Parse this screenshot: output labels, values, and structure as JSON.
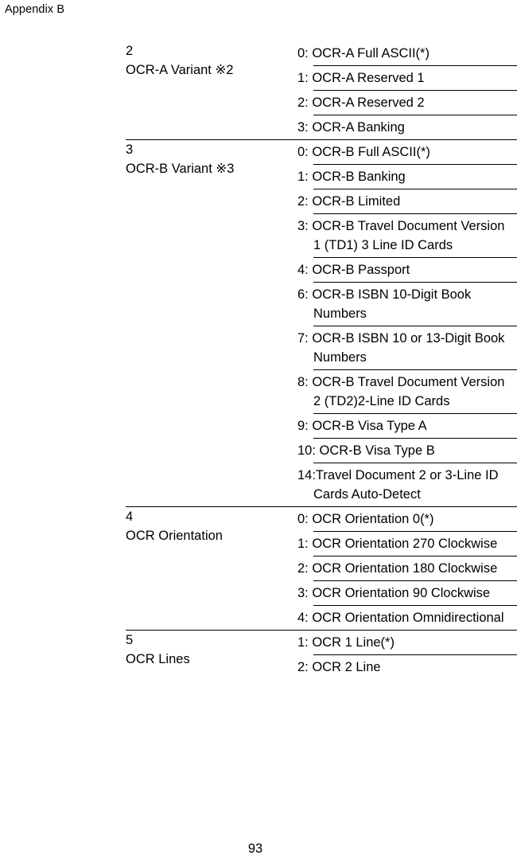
{
  "header": {
    "running_head": "Appendix B"
  },
  "footer": {
    "page_number": "93"
  },
  "table": {
    "groups": [
      {
        "number": "2",
        "name": "OCR-A Variant ※2",
        "options": [
          "0: OCR-A Full ASCII(*)",
          "1: OCR-A Reserved 1",
          "2: OCR-A Reserved 2",
          "3: OCR-A Banking"
        ]
      },
      {
        "number": "3",
        "name": "OCR-B Variant ※3",
        "options": [
          "0: OCR-B Full ASCII(*)",
          "1: OCR-B Banking",
          "2: OCR-B Limited",
          "3: OCR-B Travel Document Version 1 (TD1) 3 Line ID Cards",
          "4: OCR-B Passport",
          "6: OCR-B ISBN 10-Digit Book Numbers",
          "7: OCR-B ISBN 10 or 13-Digit Book Numbers",
          "8: OCR-B Travel Document Version 2 (TD2)2-Line ID Cards",
          "9: OCR-B Visa Type A",
          "10: OCR-B Visa Type B",
          "14:Travel Document 2 or 3-Line ID Cards Auto-Detect"
        ]
      },
      {
        "number": "4",
        "name": "OCR Orientation",
        "options": [
          "0: OCR Orientation 0(*)",
          "1: OCR Orientation 270 Clockwise",
          "2: OCR Orientation 180 Clockwise",
          "3: OCR Orientation 90 Clockwise",
          "4: OCR Orientation Omnidirectional"
        ]
      },
      {
        "number": "5",
        "name": "OCR Lines",
        "options": [
          "1: OCR 1 Line(*)",
          "2: OCR 2 Line"
        ]
      }
    ]
  }
}
